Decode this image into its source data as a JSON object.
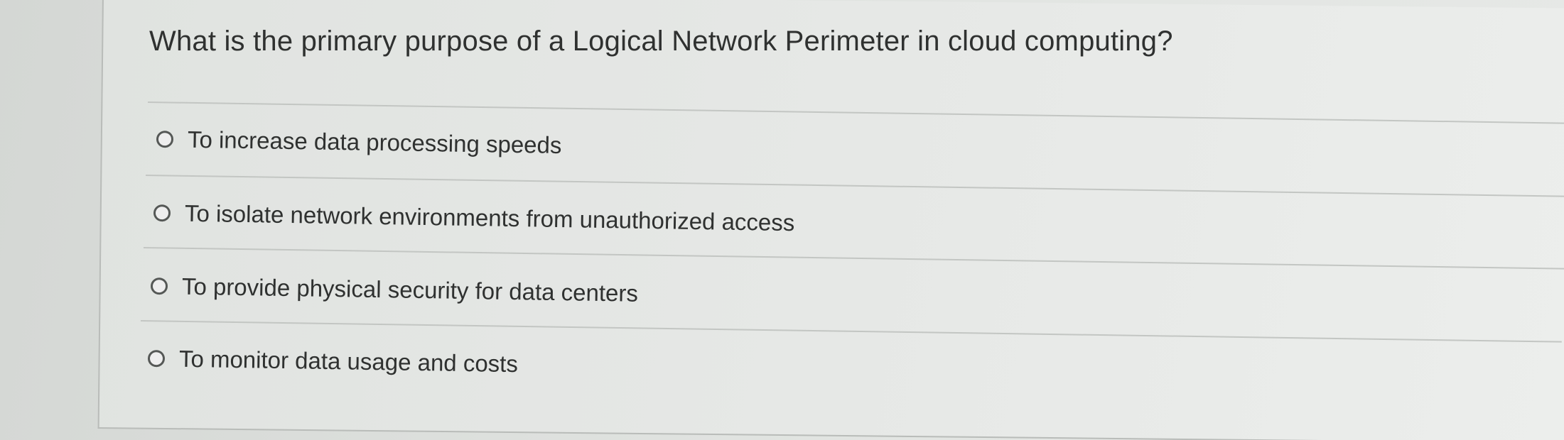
{
  "question": {
    "text": "What is the primary purpose of a Logical Network Perimeter in cloud computing?"
  },
  "options": [
    {
      "label": "To increase data processing speeds",
      "selected": false
    },
    {
      "label": "To isolate network environments from unauthorized access",
      "selected": false
    },
    {
      "label": "To provide physical security for data centers",
      "selected": false
    },
    {
      "label": "To monitor data usage and costs",
      "selected": false
    }
  ]
}
